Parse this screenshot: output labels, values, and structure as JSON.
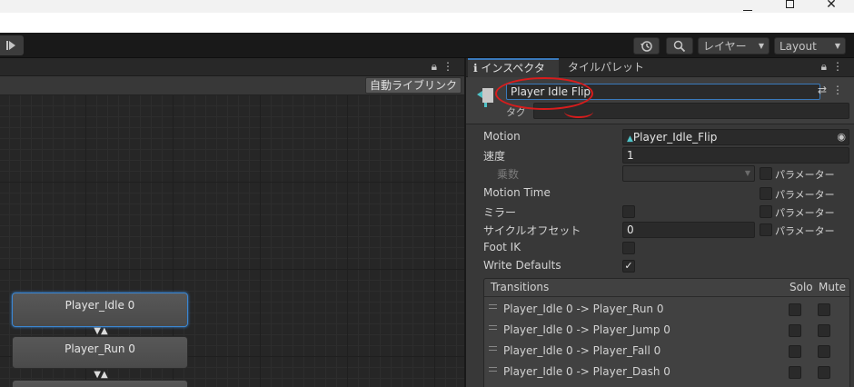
{
  "window": {
    "minimize": "—",
    "maximize": "□",
    "close": "✕"
  },
  "toolbar": {
    "step_icon": "step-forward-icon",
    "history_icon": "history-icon",
    "search_icon": "search-icon",
    "layers_label": "レイヤー",
    "layout_label": "Layout"
  },
  "animator": {
    "auto_live_link": "自動ライブリンク",
    "header_icons": "🔒︎⋮",
    "states": [
      {
        "name": "Player_Idle 0",
        "selected": true
      },
      {
        "name": "Player_Run 0",
        "selected": false
      },
      {
        "name": "",
        "selected": false
      }
    ]
  },
  "inspector": {
    "tabs": [
      {
        "label": "インスペクター",
        "icon": "info-icon",
        "active": true
      },
      {
        "label": "タイルパレット",
        "active": false
      }
    ],
    "tab_icons": "🔒︎⋮",
    "state_name": "Player  Idle Flip",
    "tag_label": "タグ",
    "tag_value": "",
    "header_icons": "⇄⋮",
    "properties": {
      "motion_label": "Motion",
      "motion_value": "Player_Idle_Flip",
      "speed_label": "速度",
      "speed_value": "1",
      "multiplier_label": "乗数",
      "motion_time_label": "Motion Time",
      "mirror_label": "ミラー",
      "cycle_offset_label": "サイクルオフセット",
      "cycle_offset_value": "0",
      "foot_ik_label": "Foot IK",
      "write_defaults_label": "Write Defaults",
      "write_defaults_checked": true,
      "parameter_label": "パラメーター"
    },
    "transitions": {
      "title": "Transitions",
      "solo_label": "Solo",
      "mute_label": "Mute",
      "items": [
        "Player_Idle 0 -> Player_Run 0",
        "Player_Idle 0 -> Player_Jump 0",
        "Player_Idle 0 -> Player_Fall 0",
        "Player_Idle 0 -> Player_Dash 0"
      ]
    }
  },
  "colors": {
    "accent_blue": "#3a79bb",
    "annotation_red": "#d91c1c",
    "panel_bg": "#383838",
    "graph_bg": "#262626"
  }
}
